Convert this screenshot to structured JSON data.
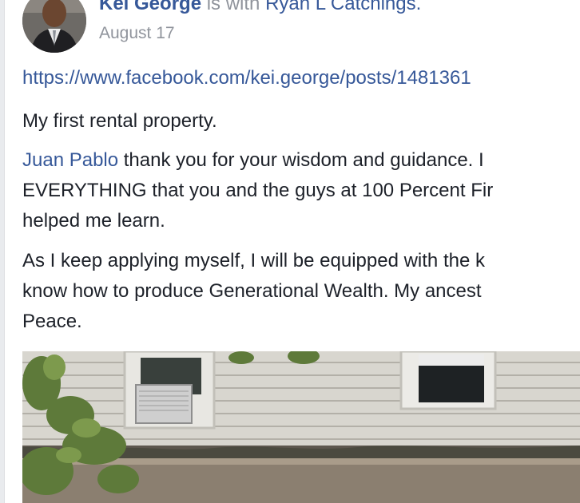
{
  "post": {
    "author": "Kei George",
    "with_text": "is with",
    "tagged_user": "Ryan L Catchings.",
    "date": "August 17",
    "link": "https://www.facebook.com/kei.george/posts/1481361",
    "paragraph1": "My first rental property.",
    "paragraph2": {
      "mention": "Juan Pablo",
      "line1_rest": " thank you for your wisdom and guidance. I",
      "line2": "EVERYTHING that you and the guys at 100 Percent Fir",
      "line3": "helped me learn."
    },
    "paragraph3": {
      "line1": "As I keep applying myself, I will be equipped with the k",
      "line2": "know how to produce Generational Wealth. My ancest",
      "line3": "Peace."
    }
  },
  "colors": {
    "link_blue": "#365899",
    "text": "#1d2129",
    "meta_gray": "#90949c"
  },
  "icons": {
    "avatar": "profile-photo",
    "photo": "house-photo"
  }
}
